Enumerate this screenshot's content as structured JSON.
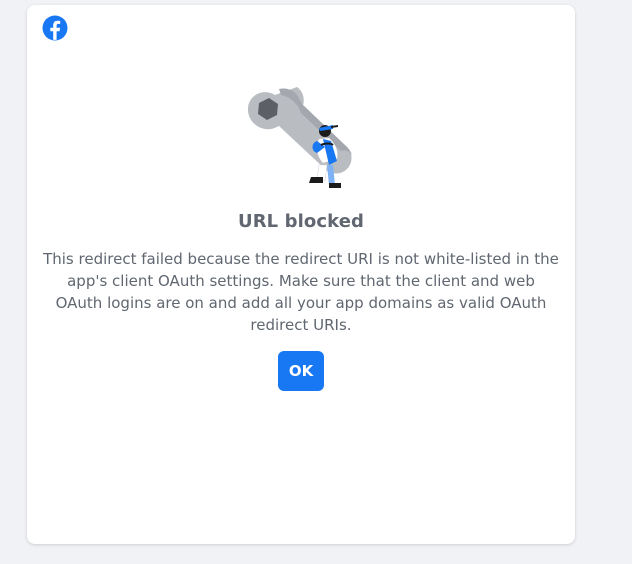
{
  "dialog": {
    "logo_icon": "facebook-icon",
    "illustration": "wrench-with-person-illustration",
    "title": "URL blocked",
    "message": "This redirect failed because the redirect URI is not white-listed in the app's client OAuth settings. Make sure that the client and web OAuth logins are on and add all your app domains as valid OAuth redirect URIs.",
    "ok_label": "OK"
  },
  "colors": {
    "brand": "#1877f2",
    "text": "#606770",
    "background": "#f0f2f5",
    "card": "#ffffff"
  }
}
